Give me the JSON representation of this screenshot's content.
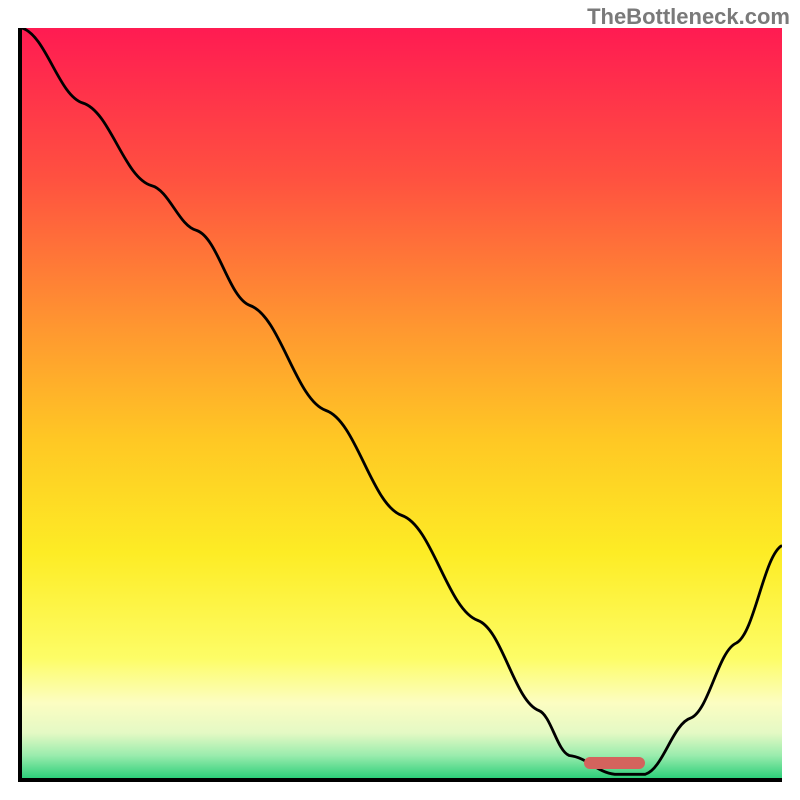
{
  "watermark": "TheBottleneck.com",
  "chart_data": {
    "type": "line",
    "title": "",
    "xlabel": "",
    "ylabel": "",
    "xlim": [
      0,
      100
    ],
    "ylim": [
      0,
      100
    ],
    "gradient_stops": [
      {
        "pct": 0,
        "color": "#ff1b52"
      },
      {
        "pct": 20,
        "color": "#ff5140"
      },
      {
        "pct": 40,
        "color": "#ff9730"
      },
      {
        "pct": 55,
        "color": "#ffc824"
      },
      {
        "pct": 70,
        "color": "#fdec25"
      },
      {
        "pct": 84,
        "color": "#fdfd66"
      },
      {
        "pct": 90,
        "color": "#fcfdc2"
      },
      {
        "pct": 94,
        "color": "#e4f9c4"
      },
      {
        "pct": 97,
        "color": "#9aecad"
      },
      {
        "pct": 100,
        "color": "#2ecf7a"
      }
    ],
    "curve": {
      "x": [
        0,
        8,
        17,
        23,
        30,
        40,
        50,
        60,
        68,
        72,
        78,
        82,
        88,
        94,
        100
      ],
      "y": [
        100,
        90,
        79,
        73,
        63,
        49,
        35,
        21,
        9,
        3,
        0.5,
        0.5,
        8,
        18,
        31
      ]
    },
    "flat_segment": {
      "x_start": 72,
      "x_end": 82,
      "y": 0.5
    },
    "marker": {
      "x_start": 74,
      "x_end": 82,
      "y": 2,
      "color": "#d4635d",
      "shape": "rounded-bar"
    }
  }
}
